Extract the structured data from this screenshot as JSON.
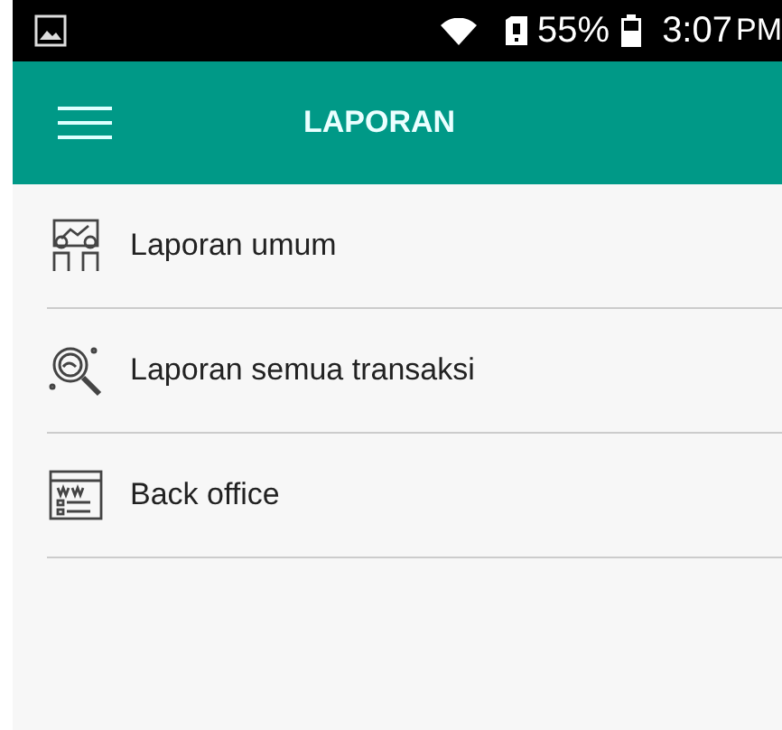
{
  "status_bar": {
    "battery": "55%",
    "time": "3:07",
    "time_suffix": "PM"
  },
  "toolbar": {
    "title": "LAPORAN"
  },
  "menu_items": [
    {
      "label": "Laporan umum"
    },
    {
      "label": "Laporan semua transaksi"
    },
    {
      "label": "Back office"
    }
  ]
}
